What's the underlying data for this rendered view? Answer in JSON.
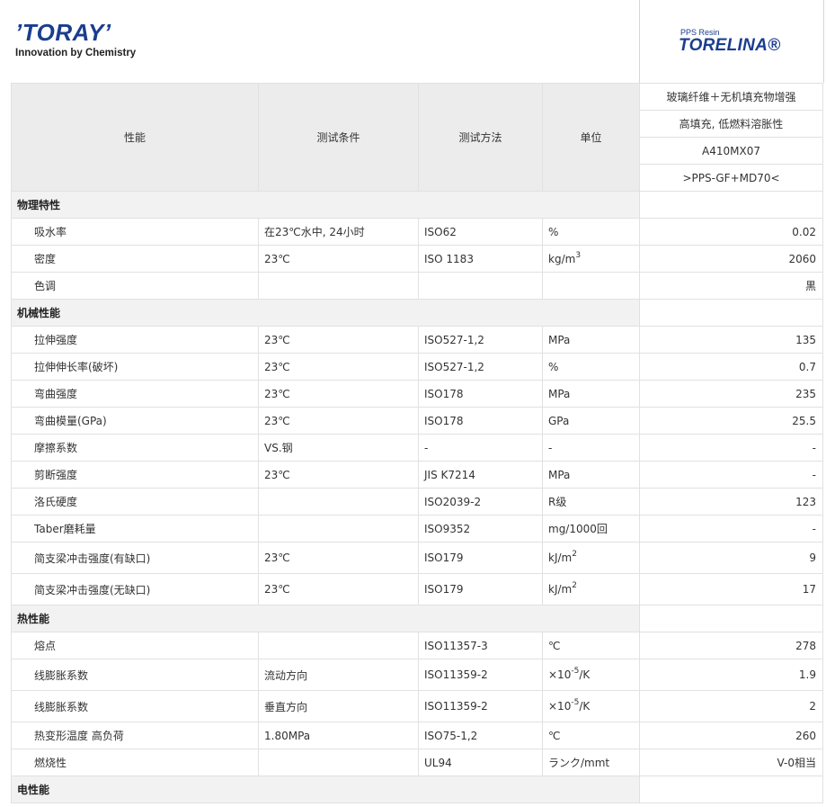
{
  "brand": {
    "logo": "’TORAY’",
    "tagline": "Innovation by Chemistry"
  },
  "product": {
    "small": "PPS Resin",
    "logo": "TORELINA®"
  },
  "header": {
    "property": "性能",
    "condition": "测试条件",
    "method": "测试方法",
    "unit": "单位",
    "desc1": "玻璃纤维＋无机填充物增强",
    "desc2": "高填充, 低燃料溶胀性",
    "grade": "A410MX07",
    "code": ">PPS-GF+MD70<"
  },
  "sections": [
    {
      "title": "物理特性",
      "rows": [
        {
          "property": "吸水率",
          "condition": "在23℃水中, 24小时",
          "method": "ISO62",
          "unit": "%",
          "value": "0.02"
        },
        {
          "property": "密度",
          "condition": "23℃",
          "method": "ISO 1183",
          "unit": "kg/m",
          "unit_sup": "3",
          "value": "2060"
        },
        {
          "property": "色调",
          "condition": "",
          "method": "",
          "unit": "",
          "value": "黒"
        }
      ]
    },
    {
      "title": "机械性能",
      "rows": [
        {
          "property": "拉伸强度",
          "condition": "23℃",
          "method": "ISO527-1,2",
          "unit": "MPa",
          "value": "135"
        },
        {
          "property": "拉伸伸长率(破坏)",
          "condition": "23℃",
          "method": "ISO527-1,2",
          "unit": "%",
          "value": "0.7"
        },
        {
          "property": "弯曲强度",
          "condition": "23℃",
          "method": "ISO178",
          "unit": "MPa",
          "value": "235"
        },
        {
          "property": "弯曲模量(GPa)",
          "condition": "23℃",
          "method": "ISO178",
          "unit": "GPa",
          "value": "25.5"
        },
        {
          "property": "摩擦系数",
          "condition": "VS.钢",
          "method": "-",
          "unit": "-",
          "value": "-"
        },
        {
          "property": "剪断强度",
          "condition": "23℃",
          "method": "JIS K7214",
          "unit": "MPa",
          "value": "-"
        },
        {
          "property": "洛氏硬度",
          "condition": "",
          "method": "ISO2039-2",
          "unit": "R级",
          "value": "123"
        },
        {
          "property": "Taber磨耗量",
          "condition": "",
          "method": "ISO9352",
          "unit": "mg/1000回",
          "value": "-"
        },
        {
          "property": "简支梁冲击强度(有缺口)",
          "condition": "23℃",
          "method": "ISO179",
          "unit": "kJ/m",
          "unit_sup": "2",
          "value": "9",
          "tall": true
        },
        {
          "property": "简支梁冲击强度(无缺口)",
          "condition": "23℃",
          "method": "ISO179",
          "unit": "kJ/m",
          "unit_sup": "2",
          "value": "17",
          "tall": true
        }
      ]
    },
    {
      "title": "热性能",
      "rows": [
        {
          "property": "熔点",
          "condition": "",
          "method": "ISO11357-3",
          "unit": "℃",
          "value": "278"
        },
        {
          "property": "线膨胀系数",
          "condition": "流动方向",
          "method": "ISO11359-2",
          "unit": "×10",
          "unit_sup": "-5",
          "unit_tail": "/K",
          "value": "1.9",
          "tall": true
        },
        {
          "property": "线膨胀系数",
          "condition": "垂直方向",
          "method": "ISO11359-2",
          "unit": "×10",
          "unit_sup": "-5",
          "unit_tail": "/K",
          "value": "2",
          "tall": true
        },
        {
          "property": "热变形温度 高负荷",
          "condition": "1.80MPa",
          "method": "ISO75-1,2",
          "unit": "℃",
          "value": "260"
        },
        {
          "property": "燃烧性",
          "condition": "",
          "method": "UL94",
          "unit": "ランク/mmt",
          "value": "V-0相当"
        }
      ]
    },
    {
      "title": "电性能",
      "rows": []
    }
  ]
}
